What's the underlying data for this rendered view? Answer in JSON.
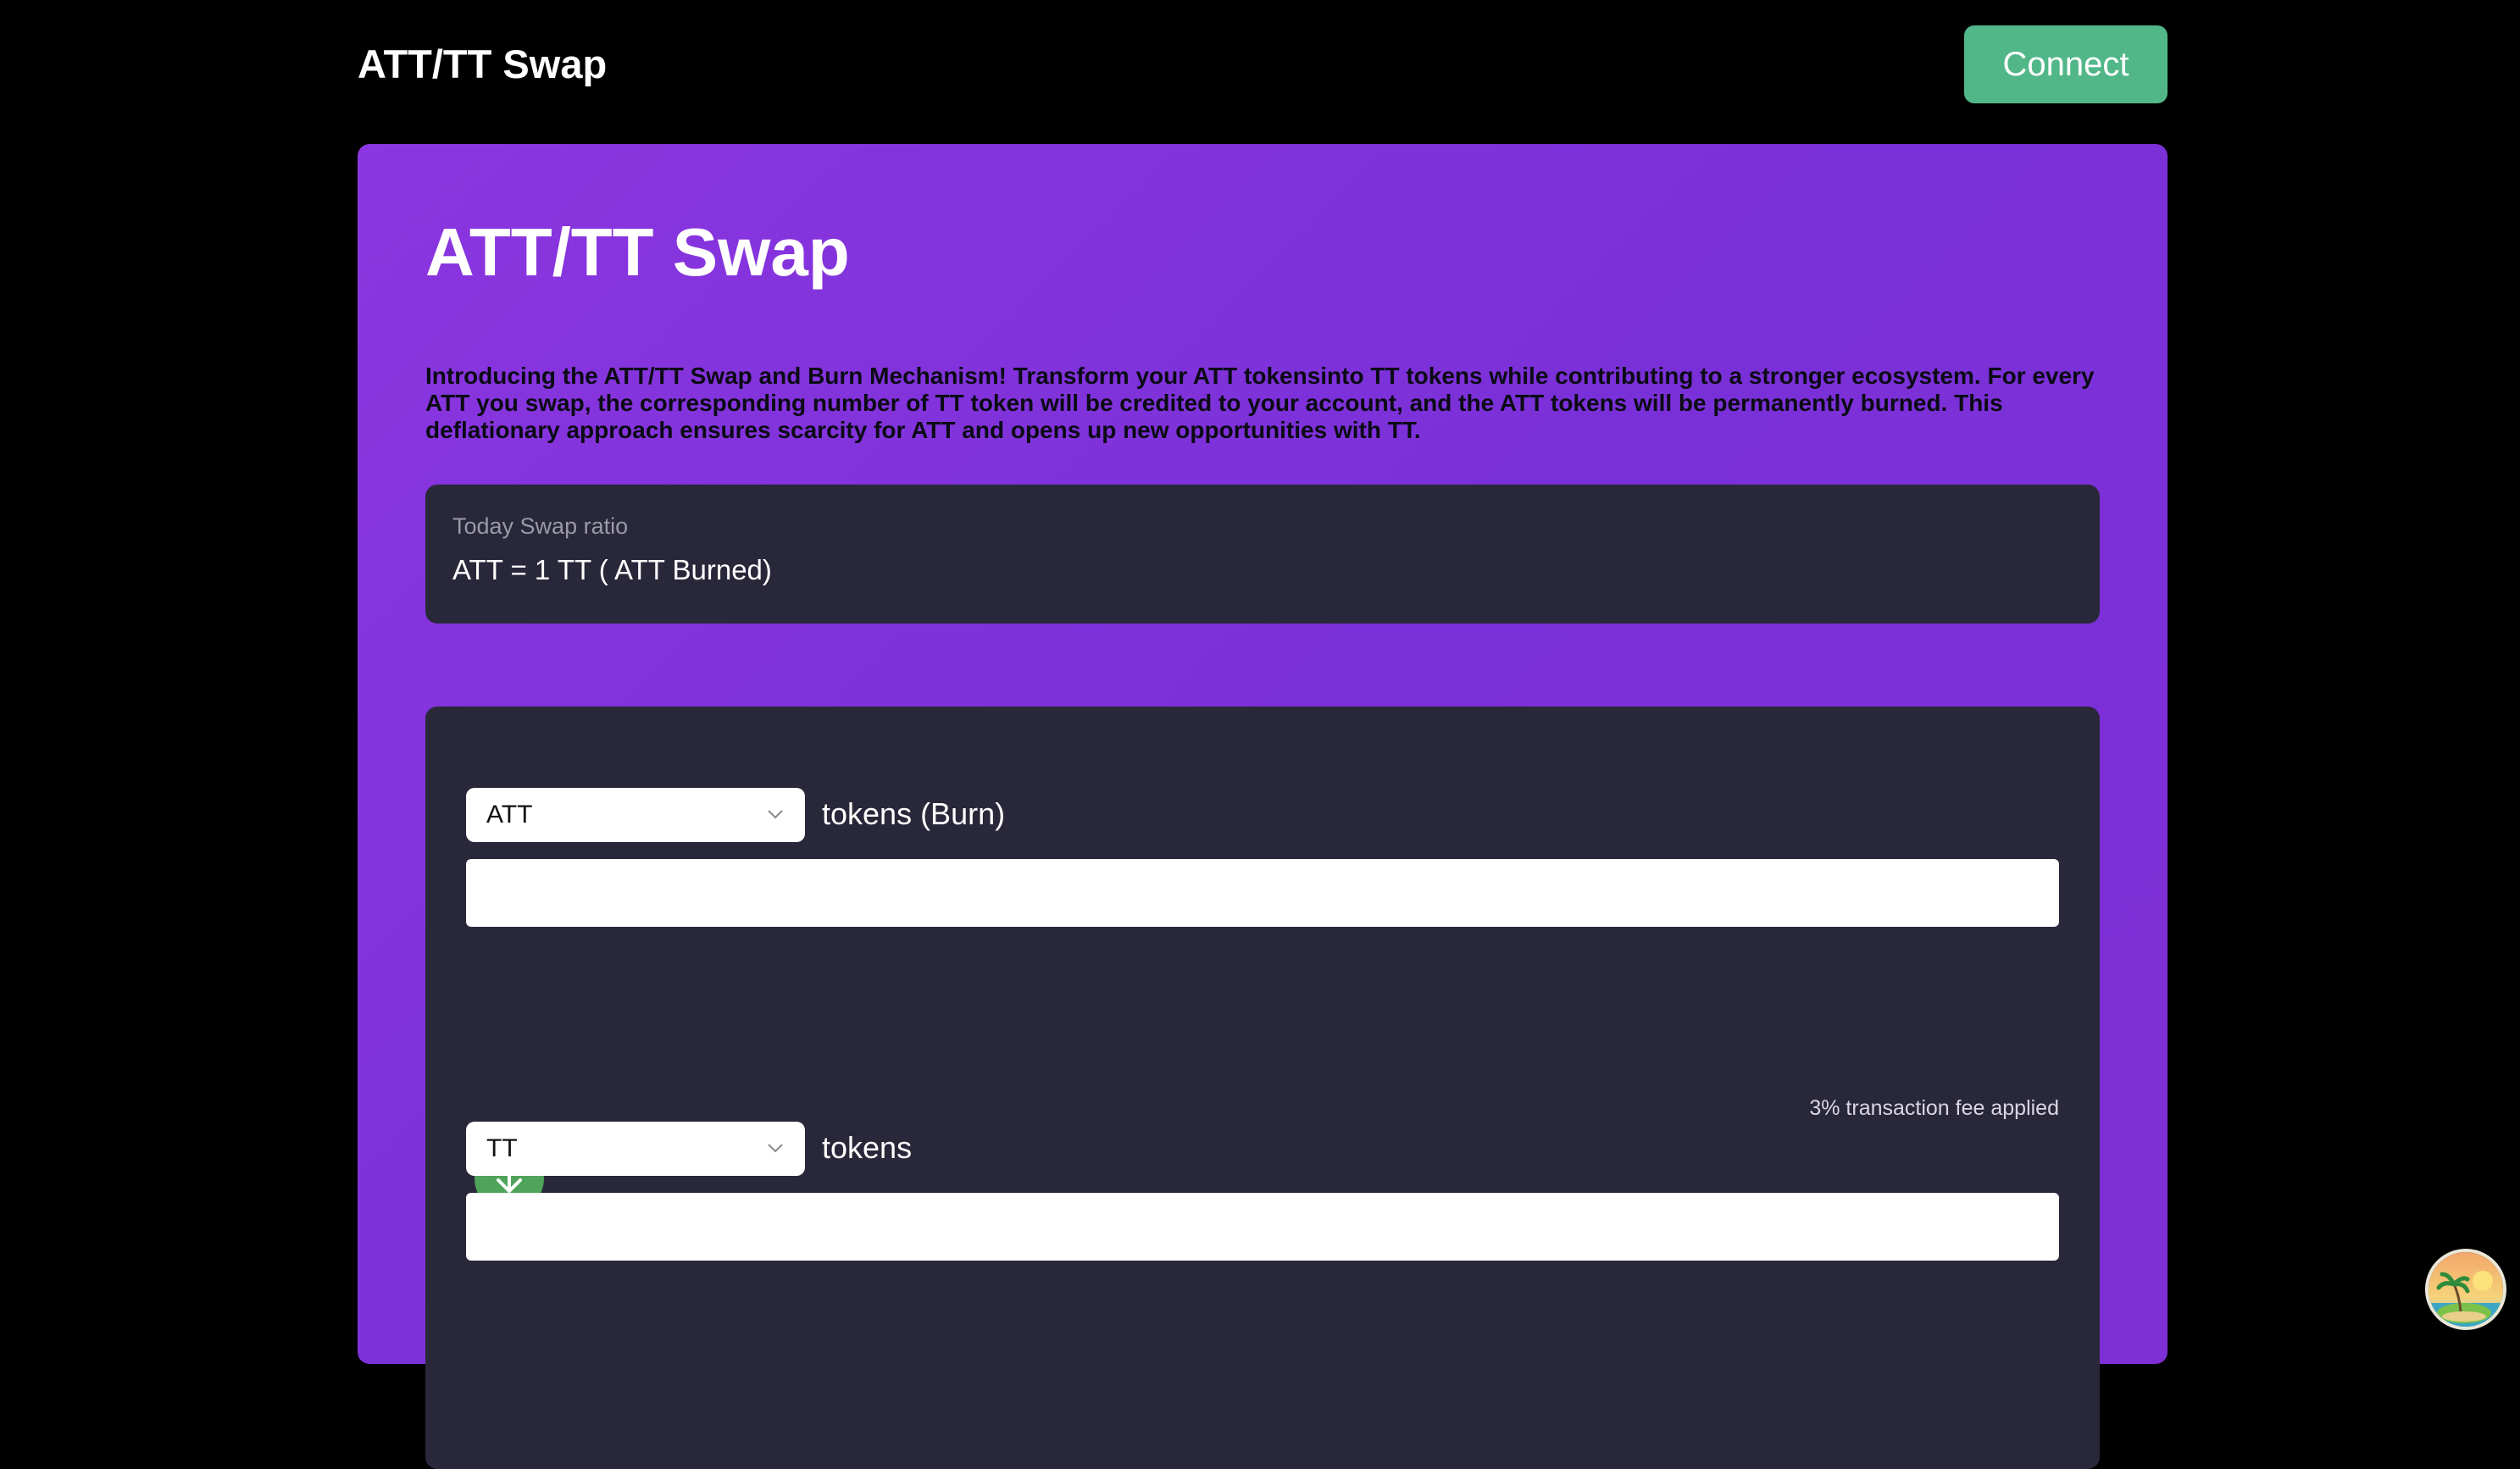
{
  "header": {
    "brand": "ATT/TT Swap",
    "connect_label": "Connect"
  },
  "main": {
    "title": "ATT/TT Swap",
    "intro": "Introducing the ATT/TT Swap and Burn Mechanism! Transform your ATT tokensinto TT tokens while contributing to a stronger ecosystem. For every ATT you swap, the corresponding number of TT token will be credited to your account, and the ATT tokens will be permanently burned. This deflationary approach ensures scarcity for ATT and opens up new opportunities with TT.",
    "ratio": {
      "label": "Today Swap ratio",
      "value": "ATT = 1 TT ( ATT Burned)"
    },
    "from": {
      "selected": "ATT",
      "label": "tokens (Burn)",
      "amount": "",
      "fee_note": "3% transaction fee applied"
    },
    "to": {
      "selected": "TT",
      "label": "tokens",
      "amount": ""
    }
  },
  "colors": {
    "background": "#000000",
    "panel": "#8033db",
    "card": "#29283a",
    "connect": "#52b788",
    "arrow": "#4fa35a"
  },
  "icons": {
    "swap_direction": "arrow-down-icon",
    "select_chevron": "chevron-down-icon",
    "avatar": "island-avatar-icon"
  }
}
